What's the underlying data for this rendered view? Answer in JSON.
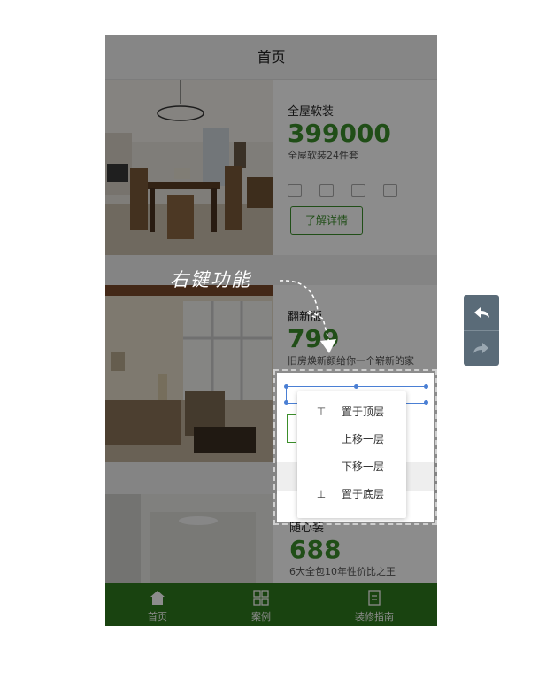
{
  "header": {
    "title": "首页"
  },
  "cards": [
    {
      "name": "全屋软装",
      "price": "399000",
      "desc": "全屋软装24件套",
      "button": "了解详情"
    },
    {
      "name": "翻新版",
      "price": "799",
      "desc": "旧房焕新颜给你一个崭新的家"
    },
    {
      "name": "随心装",
      "price": "688",
      "desc": "6大全包10年性价比之王"
    }
  ],
  "tabbar": {
    "items": [
      {
        "label": "首页"
      },
      {
        "label": "案例"
      },
      {
        "label": "装修指南"
      }
    ]
  },
  "context_menu": {
    "items": [
      {
        "label": "置于顶层",
        "icon": "⊤"
      },
      {
        "label": "上移一层",
        "icon": ""
      },
      {
        "label": "下移一层",
        "icon": ""
      },
      {
        "label": "置于底层",
        "icon": "⊥"
      }
    ]
  },
  "annotation": {
    "text": "右键功能"
  },
  "colors": {
    "accent": "#3b8e2a",
    "tabbar": "#2f7a1e",
    "panel": "#5a6b78"
  },
  "controls": {
    "undo_icon": "undo-icon",
    "redo_icon": "redo-icon"
  }
}
